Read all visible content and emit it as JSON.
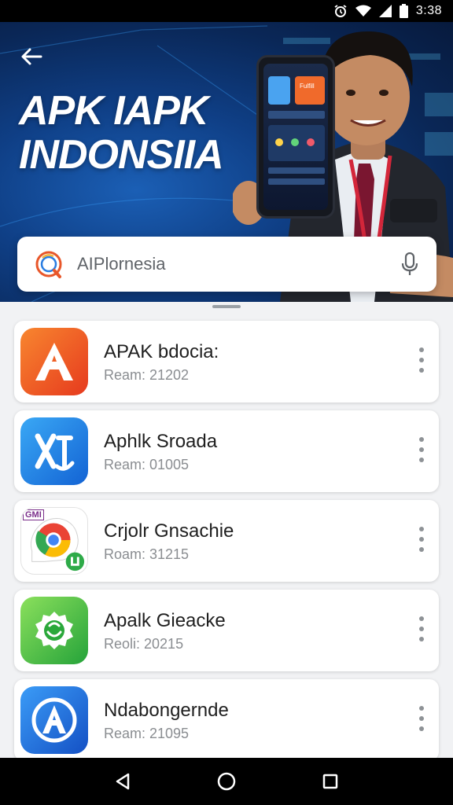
{
  "status_bar": {
    "time": "3:38",
    "icons": [
      "alarm-icon",
      "wifi-icon",
      "signal-icon",
      "battery-icon"
    ]
  },
  "hero": {
    "title_line1": "APK IAPK",
    "title_line2": "INDONSIIA",
    "back_icon": "arrow-left-icon",
    "phone_screen_label": "Fulfill"
  },
  "search": {
    "value": "AIPlornesia",
    "logo_icon": "search-logo-icon",
    "mic_icon": "microphone-icon"
  },
  "apps": [
    {
      "name": "APAK bdocia:",
      "meta": "Ream: 21202",
      "icon": "letter-a-orange-icon",
      "colors": [
        "#f26b2a",
        "#e8361f"
      ]
    },
    {
      "name": "Aphlk Sroada",
      "meta": "Ream: 01005",
      "icon": "x-app-blue-icon",
      "colors": [
        "#2d9cf2",
        "#1565d6"
      ]
    },
    {
      "name": "Crjolr Gnsachie",
      "meta": "Roam: 31215",
      "icon": "chrome-chat-icon",
      "colors": [
        "#ffffff",
        "#e6e6e6"
      ],
      "badge": "GMI"
    },
    {
      "name": "Apalk Gieacke",
      "meta": "Reoli: 20215",
      "icon": "green-chat-icon",
      "colors": [
        "#7ed957",
        "#2aa83a"
      ]
    },
    {
      "name": "Ndabongernde",
      "meta": "Ream: 21095",
      "icon": "letter-a-blue-icon",
      "colors": [
        "#2f8df5",
        "#1556c9"
      ]
    }
  ],
  "nav": {
    "back_icon": "nav-back-icon",
    "home_icon": "nav-home-icon",
    "recents_icon": "nav-recents-icon"
  }
}
